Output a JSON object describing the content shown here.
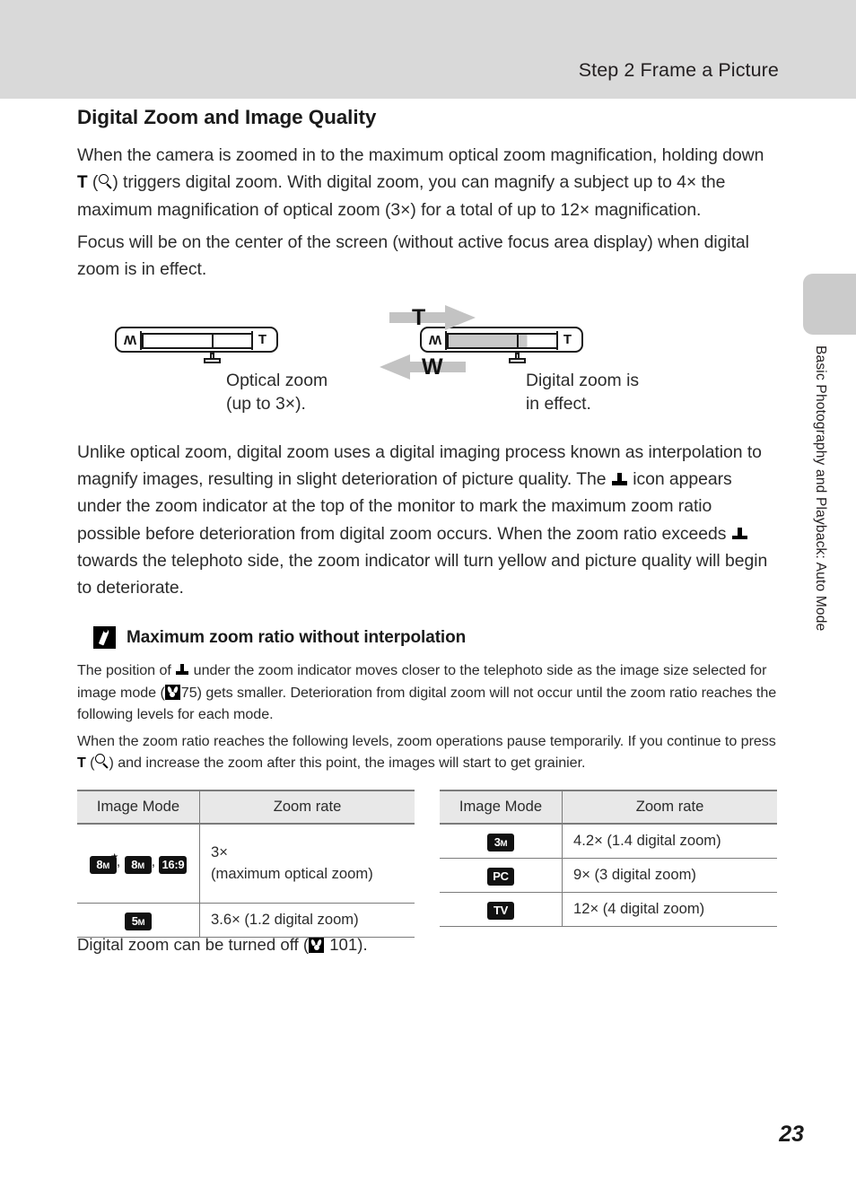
{
  "header": {
    "title": "Step 2 Frame a Picture",
    "band_color": "#d9d9d9"
  },
  "side_tab": {
    "label": "Basic Photography and Playback: Auto Mode",
    "color": "#cbcbcb"
  },
  "section": {
    "heading": "Digital Zoom and Image Quality",
    "paragraph_1_a": "When the camera is zoomed in to the maximum optical zoom magnification, holding down ",
    "paragraph_1_t": "T",
    "paragraph_1_b": ") triggers digital zoom. With digital zoom, you can magnify a subject up to 4× the maximum magnification of optical zoom (3×) for a total of up to 12× magnification.",
    "paragraph_2": "Focus will be on the center of the screen (without active focus area display) when digital zoom is in effect.",
    "paragraph_3_a": "Unlike optical zoom, digital zoom uses a digital imaging process known as interpolation to magnify images, resulting in slight deterioration of picture quality. The ",
    "paragraph_3_b": " icon appears under the zoom indicator at the top of the monitor to mark the maximum zoom ratio possible before deterioration from digital zoom occurs. When the zoom ratio exceeds ",
    "paragraph_3_c": " towards the telephoto side, the zoom indicator will turn yellow and picture quality will begin to deteriorate."
  },
  "figure": {
    "left_bar": {
      "w_label": "W",
      "t_label": "T",
      "optical_filled": false,
      "digital_filled": false
    },
    "right_bar": {
      "w_label": "W",
      "t_label": "T",
      "optical_filled": true,
      "digital_filled": true
    },
    "arrow_t_label": "T",
    "arrow_w_label": "W",
    "arrow_color": "#c3c3c3",
    "caption_left_line1": "Optical zoom",
    "caption_left_line2": "(up to 3×).",
    "caption_right_line1": "Digital zoom is",
    "caption_right_line2": "in effect."
  },
  "note": {
    "title": "Maximum zoom ratio without interpolation",
    "icon": "pencil-icon",
    "para_1_a": "The position of ",
    "para_1_b": " under the zoom indicator moves closer to the telephoto side as the image size selected for image mode (",
    "para_1_ref": "75",
    "para_1_c": ") gets smaller. Deterioration from digital zoom will not occur until the zoom ratio reaches the following levels for each mode.",
    "para_2_a": "When the zoom ratio reaches the following levels, zoom operations pause temporarily. If you continue to press ",
    "para_2_t": "T",
    "para_2_b": ") and increase the zoom after this point, the images will start to get grainier."
  },
  "tables": {
    "headers": [
      "Image Mode",
      "Zoom rate"
    ],
    "left_rows": [
      {
        "modes": [
          {
            "text": "8",
            "sub": "M",
            "starred": true
          },
          {
            "text": "8",
            "sub": "M",
            "starred": false
          },
          {
            "text": "16:9",
            "sub": "",
            "starred": false
          }
        ],
        "rate_line1": "3×",
        "rate_line2": "(maximum optical zoom)"
      },
      {
        "modes": [
          {
            "text": "5",
            "sub": "M",
            "starred": false
          }
        ],
        "rate_line1": "3.6× (1.2 digital zoom)",
        "rate_line2": ""
      }
    ],
    "right_rows": [
      {
        "modes": [
          {
            "text": "3",
            "sub": "M",
            "starred": false
          }
        ],
        "rate_line1": "4.2× (1.4 digital zoom)",
        "rate_line2": ""
      },
      {
        "modes": [
          {
            "text": "PC",
            "sub": "",
            "starred": false
          }
        ],
        "rate_line1": "9× (3 digital zoom)",
        "rate_line2": ""
      },
      {
        "modes": [
          {
            "text": "TV",
            "sub": "",
            "starred": false
          }
        ],
        "rate_line1": "12× (4 digital zoom)",
        "rate_line2": ""
      }
    ]
  },
  "tail": {
    "text_a": "Digital zoom can be turned off (",
    "ref": "101",
    "text_b": ")."
  },
  "page_number": "23"
}
